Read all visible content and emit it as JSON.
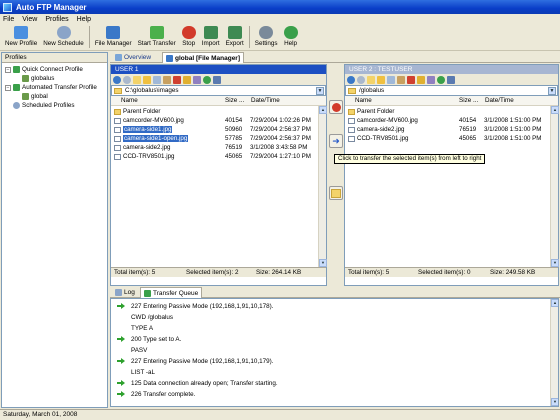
{
  "window": {
    "title": "Auto FTP Manager"
  },
  "menu": [
    "File",
    "View",
    "Profiles",
    "Help"
  ],
  "toolbar": [
    {
      "label": "New Profile",
      "icon": "new-profile-icon",
      "color": "#4a8fe0"
    },
    {
      "label": "New Schedule",
      "icon": "new-schedule-icon",
      "color": "#8aa4c8"
    },
    {
      "label": "File Manager",
      "icon": "file-manager-icon",
      "color": "#3a78c8"
    },
    {
      "label": "Start Transfer",
      "icon": "start-transfer-icon",
      "color": "#4bb04b"
    },
    {
      "label": "Stop",
      "icon": "stop-icon",
      "color": "#d23a2a"
    },
    {
      "label": "Import",
      "icon": "import-icon",
      "color": "#3e8a52"
    },
    {
      "label": "Export",
      "icon": "export-icon",
      "color": "#3e8a52"
    },
    {
      "label": "Settings",
      "icon": "settings-icon",
      "color": "#7a8a9a"
    },
    {
      "label": "Help",
      "icon": "help-icon",
      "color": "#3aa04a"
    }
  ],
  "profiles": {
    "title": "Profiles",
    "tree": [
      {
        "label": "Quick Connect Profile"
      },
      {
        "label": "globalus"
      },
      {
        "label": "Automated Transfer Profile"
      },
      {
        "label": "global"
      },
      {
        "label": "Scheduled Profiles"
      }
    ]
  },
  "tabs": [
    {
      "label": "Overview"
    },
    {
      "label": "global [File Manager]"
    }
  ],
  "left_pane": {
    "header": "USER 1",
    "path": "C:\\globalus\\images",
    "columns": [
      "Name",
      "Size ...",
      "Date/Time"
    ],
    "rows": [
      {
        "name": "Parent Folder",
        "size": "",
        "date": ""
      },
      {
        "name": "camcorder-MV600.jpg",
        "size": "40154",
        "date": "7/29/2004 1:02:26 PM"
      },
      {
        "name": "camera-side1.jpg",
        "size": "50960",
        "date": "7/29/2004 2:56:37 PM"
      },
      {
        "name": "camera-side1-open.jpg",
        "size": "57785",
        "date": "7/29/2004 2:56:37 PM"
      },
      {
        "name": "camera-side2.jpg",
        "size": "76519",
        "date": "3/1/2008 3:43:58 PM"
      },
      {
        "name": "CCD-TRV8501.jpg",
        "size": "45065",
        "date": "7/29/2004 1:27:10 PM"
      }
    ],
    "status": {
      "total": "Total item(s): 5",
      "selected": "Selected item(s): 2",
      "size": "Size: 264.14 KB"
    }
  },
  "right_pane": {
    "header": "USER 2 : TESTUSER",
    "path": "/globalus",
    "columns": [
      "Name",
      "Size ...",
      "Date/Time"
    ],
    "rows": [
      {
        "name": "Parent Folder",
        "size": "",
        "date": ""
      },
      {
        "name": "camcorder-MV600.jpg",
        "size": "40154",
        "date": "3/1/2008 1:51:00 PM"
      },
      {
        "name": "camera-side2.jpg",
        "size": "76519",
        "date": "3/1/2008 1:51:00 PM"
      },
      {
        "name": "CCD-TRV8501.jpg",
        "size": "45065",
        "date": "3/1/2008 1:51:00 PM"
      }
    ],
    "status": {
      "total": "Total item(s): 5",
      "selected": "Selected item(s): 0",
      "size": "Size: 249.58 KB"
    }
  },
  "tooltip": "Click to transfer the selected item(s) from left to right",
  "log_tabs": [
    {
      "label": "Log"
    },
    {
      "label": "Transfer Queue"
    }
  ],
  "log": [
    "227 Entering Passive Mode (192,168,1,91,10,178).",
    "CWD /globalus",
    "TYPE A",
    "200 Type set to A.",
    "PASV",
    "227 Entering Passive Mode (192,168,1,91,10,179).",
    "LIST -aL",
    "125 Data connection already open; Transfer starting.",
    "226 Transfer complete."
  ],
  "footer": "Saturday, March 01, 2008",
  "colors": {
    "pane_header_active": "#1c4fc2",
    "pane_header_inactive": "#a7b6d2",
    "selection": "#316ac5"
  }
}
